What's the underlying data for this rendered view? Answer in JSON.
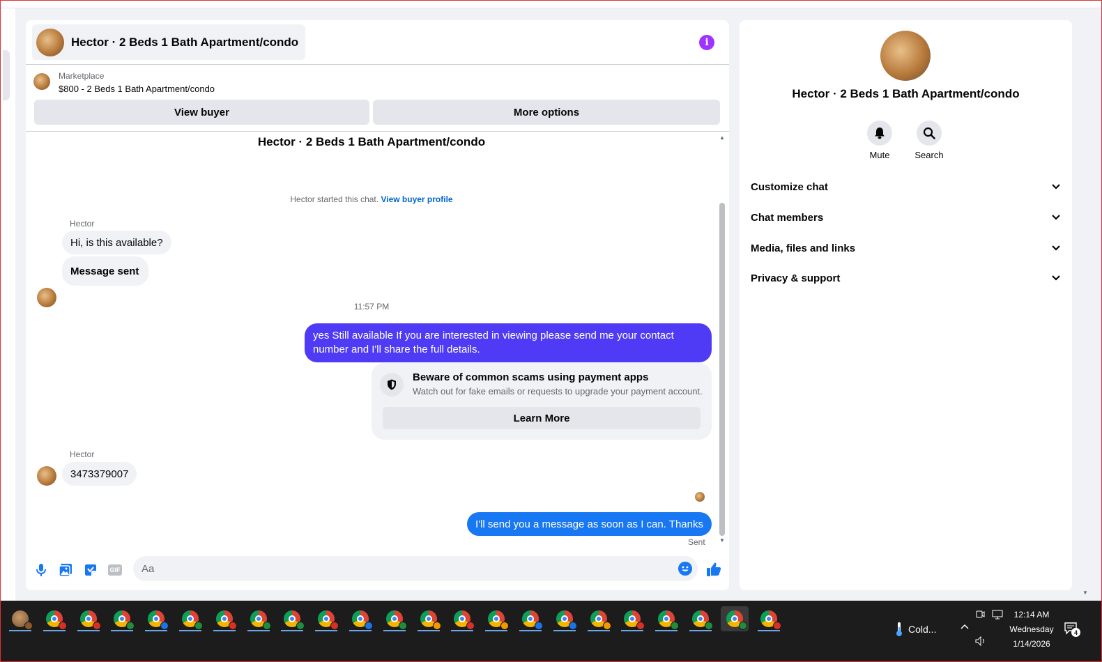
{
  "header": {
    "title": "Hector · 2 Beds 1 Bath Apartment/condo"
  },
  "marketplace": {
    "label": "Marketplace",
    "listing": "$800 - 2 Beds 1 Bath Apartment/condo",
    "view_buyer": "View buyer",
    "more_options": "More options"
  },
  "conversation": {
    "title": "Hector · 2 Beds 1 Bath Apartment/condo",
    "started_text": "Hector started this chat.",
    "view_profile": "View buyer profile",
    "messages": [
      {
        "sender": "Hector",
        "text": "Hi, is this available?"
      },
      {
        "text": "Message sent"
      },
      {
        "time": "11:57 PM"
      },
      {
        "text": "yes Still available If you are interested in viewing please send me your contact number and I'll share the full details."
      },
      {
        "sender": "Hector",
        "text": "3473379007"
      },
      {
        "text": "I'll send you a message as soon as I can. Thanks",
        "status": "Sent"
      }
    ],
    "scam_notice": {
      "title": "Beware of common scams using payment apps",
      "subtitle": "Watch out for fake emails or requests to upgrade your payment account.",
      "button": "Learn More"
    }
  },
  "composer": {
    "placeholder": "Aa",
    "gif_label": "GIF"
  },
  "sidebar": {
    "title": "Hector · 2 Beds 1 Bath Apartment/condo",
    "actions": [
      {
        "label": "Mute",
        "icon": "bell-icon"
      },
      {
        "label": "Search",
        "icon": "search-icon"
      }
    ],
    "sections": [
      "Customize chat",
      "Chat members",
      "Media, files and links",
      "Privacy & support"
    ]
  },
  "taskbar": {
    "weather": "Cold...",
    "time": "12:14 AM",
    "day": "Wednesday",
    "date": "1/14/2026",
    "notification_count": "4"
  },
  "colors": {
    "outgoing_purple": "#4f3bf5",
    "outgoing_blue": "#1877f2",
    "accent": "#0064d1",
    "info": "#a033ff"
  }
}
